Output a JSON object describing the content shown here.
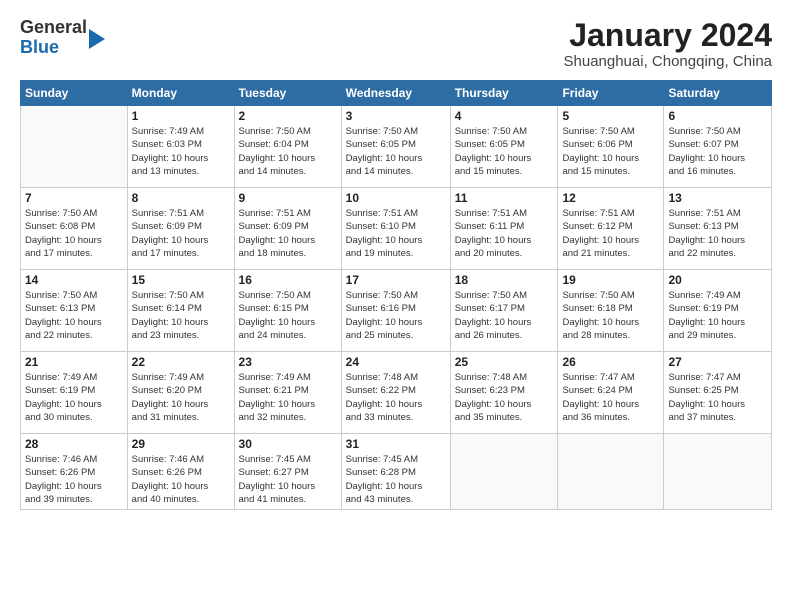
{
  "logo": {
    "line1": "General",
    "line2": "Blue"
  },
  "title": "January 2024",
  "location": "Shuanghuai, Chongqing, China",
  "days_header": [
    "Sunday",
    "Monday",
    "Tuesday",
    "Wednesday",
    "Thursday",
    "Friday",
    "Saturday"
  ],
  "weeks": [
    [
      {
        "num": "",
        "info": ""
      },
      {
        "num": "1",
        "info": "Sunrise: 7:49 AM\nSunset: 6:03 PM\nDaylight: 10 hours\nand 13 minutes."
      },
      {
        "num": "2",
        "info": "Sunrise: 7:50 AM\nSunset: 6:04 PM\nDaylight: 10 hours\nand 14 minutes."
      },
      {
        "num": "3",
        "info": "Sunrise: 7:50 AM\nSunset: 6:05 PM\nDaylight: 10 hours\nand 14 minutes."
      },
      {
        "num": "4",
        "info": "Sunrise: 7:50 AM\nSunset: 6:05 PM\nDaylight: 10 hours\nand 15 minutes."
      },
      {
        "num": "5",
        "info": "Sunrise: 7:50 AM\nSunset: 6:06 PM\nDaylight: 10 hours\nand 15 minutes."
      },
      {
        "num": "6",
        "info": "Sunrise: 7:50 AM\nSunset: 6:07 PM\nDaylight: 10 hours\nand 16 minutes."
      }
    ],
    [
      {
        "num": "7",
        "info": "Sunrise: 7:50 AM\nSunset: 6:08 PM\nDaylight: 10 hours\nand 17 minutes."
      },
      {
        "num": "8",
        "info": "Sunrise: 7:51 AM\nSunset: 6:09 PM\nDaylight: 10 hours\nand 17 minutes."
      },
      {
        "num": "9",
        "info": "Sunrise: 7:51 AM\nSunset: 6:09 PM\nDaylight: 10 hours\nand 18 minutes."
      },
      {
        "num": "10",
        "info": "Sunrise: 7:51 AM\nSunset: 6:10 PM\nDaylight: 10 hours\nand 19 minutes."
      },
      {
        "num": "11",
        "info": "Sunrise: 7:51 AM\nSunset: 6:11 PM\nDaylight: 10 hours\nand 20 minutes."
      },
      {
        "num": "12",
        "info": "Sunrise: 7:51 AM\nSunset: 6:12 PM\nDaylight: 10 hours\nand 21 minutes."
      },
      {
        "num": "13",
        "info": "Sunrise: 7:51 AM\nSunset: 6:13 PM\nDaylight: 10 hours\nand 22 minutes."
      }
    ],
    [
      {
        "num": "14",
        "info": "Sunrise: 7:50 AM\nSunset: 6:13 PM\nDaylight: 10 hours\nand 22 minutes."
      },
      {
        "num": "15",
        "info": "Sunrise: 7:50 AM\nSunset: 6:14 PM\nDaylight: 10 hours\nand 23 minutes."
      },
      {
        "num": "16",
        "info": "Sunrise: 7:50 AM\nSunset: 6:15 PM\nDaylight: 10 hours\nand 24 minutes."
      },
      {
        "num": "17",
        "info": "Sunrise: 7:50 AM\nSunset: 6:16 PM\nDaylight: 10 hours\nand 25 minutes."
      },
      {
        "num": "18",
        "info": "Sunrise: 7:50 AM\nSunset: 6:17 PM\nDaylight: 10 hours\nand 26 minutes."
      },
      {
        "num": "19",
        "info": "Sunrise: 7:50 AM\nSunset: 6:18 PM\nDaylight: 10 hours\nand 28 minutes."
      },
      {
        "num": "20",
        "info": "Sunrise: 7:49 AM\nSunset: 6:19 PM\nDaylight: 10 hours\nand 29 minutes."
      }
    ],
    [
      {
        "num": "21",
        "info": "Sunrise: 7:49 AM\nSunset: 6:19 PM\nDaylight: 10 hours\nand 30 minutes."
      },
      {
        "num": "22",
        "info": "Sunrise: 7:49 AM\nSunset: 6:20 PM\nDaylight: 10 hours\nand 31 minutes."
      },
      {
        "num": "23",
        "info": "Sunrise: 7:49 AM\nSunset: 6:21 PM\nDaylight: 10 hours\nand 32 minutes."
      },
      {
        "num": "24",
        "info": "Sunrise: 7:48 AM\nSunset: 6:22 PM\nDaylight: 10 hours\nand 33 minutes."
      },
      {
        "num": "25",
        "info": "Sunrise: 7:48 AM\nSunset: 6:23 PM\nDaylight: 10 hours\nand 35 minutes."
      },
      {
        "num": "26",
        "info": "Sunrise: 7:47 AM\nSunset: 6:24 PM\nDaylight: 10 hours\nand 36 minutes."
      },
      {
        "num": "27",
        "info": "Sunrise: 7:47 AM\nSunset: 6:25 PM\nDaylight: 10 hours\nand 37 minutes."
      }
    ],
    [
      {
        "num": "28",
        "info": "Sunrise: 7:46 AM\nSunset: 6:26 PM\nDaylight: 10 hours\nand 39 minutes."
      },
      {
        "num": "29",
        "info": "Sunrise: 7:46 AM\nSunset: 6:26 PM\nDaylight: 10 hours\nand 40 minutes."
      },
      {
        "num": "30",
        "info": "Sunrise: 7:45 AM\nSunset: 6:27 PM\nDaylight: 10 hours\nand 41 minutes."
      },
      {
        "num": "31",
        "info": "Sunrise: 7:45 AM\nSunset: 6:28 PM\nDaylight: 10 hours\nand 43 minutes."
      },
      {
        "num": "",
        "info": ""
      },
      {
        "num": "",
        "info": ""
      },
      {
        "num": "",
        "info": ""
      }
    ]
  ]
}
